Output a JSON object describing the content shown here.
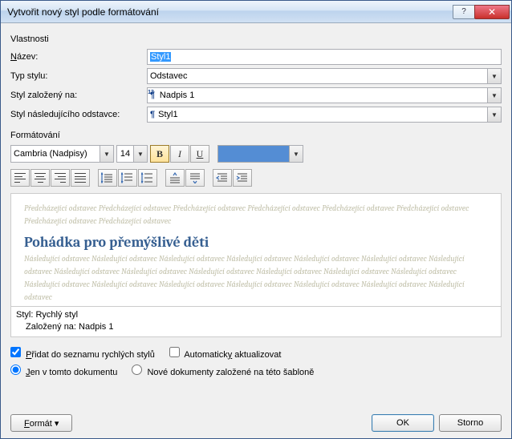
{
  "title": "Vytvořit nový styl podle formátování",
  "sections": {
    "properties": "Vlastnosti",
    "formatting": "Formátování"
  },
  "labels": {
    "name_u": "N",
    "name_rest": "ázev:",
    "type": "Typ stylu:",
    "based_on": "Styl založený na:",
    "following": "Styl následujícího odstavce:"
  },
  "values": {
    "name": "Styl1",
    "type": "Odstavec",
    "based_on": "Nadpis 1",
    "following": "Styl1"
  },
  "formatting": {
    "font": "Cambria (Nadpisy)",
    "size": "14",
    "color": "#548dd4"
  },
  "preview": {
    "preceding": "Předcházející odstavec Předcházející odstavec Předcházející odstavec Předcházející odstavec Předcházející odstavec Předcházející odstavec Předcházející odstavec Předcházející odstavec",
    "sample": "Pohádka pro přemýšlivé děti",
    "following": "Následující odstavec Následující odstavec Následující odstavec Následující odstavec Následující odstavec Následující odstavec Následující odstavec Následující odstavec Následující odstavec Následující odstavec Následující odstavec Následující odstavec Následující odstavec Následující odstavec Následující odstavec Následující odstavec Následující odstavec Následující odstavec Následující odstavec Následující odstavec"
  },
  "description": {
    "line1": "Styl: Rychlý styl",
    "line2": "Založený na: Nadpis 1"
  },
  "checkboxes": {
    "quick_u": "P",
    "quick_rest": "řidat do seznamu rychlých stylů",
    "auto_pre": "Automatick",
    "auto_u": "y",
    "auto_rest": " aktualizovat"
  },
  "radios": {
    "thisdoc_u": "J",
    "thisdoc_rest": "en v tomto dokumentu",
    "newdocs": "Nové dokumenty založené na této šabloně"
  },
  "buttons": {
    "format_u": "F",
    "format_rest": "ormát ▾",
    "ok": "OK",
    "cancel": "Storno"
  }
}
